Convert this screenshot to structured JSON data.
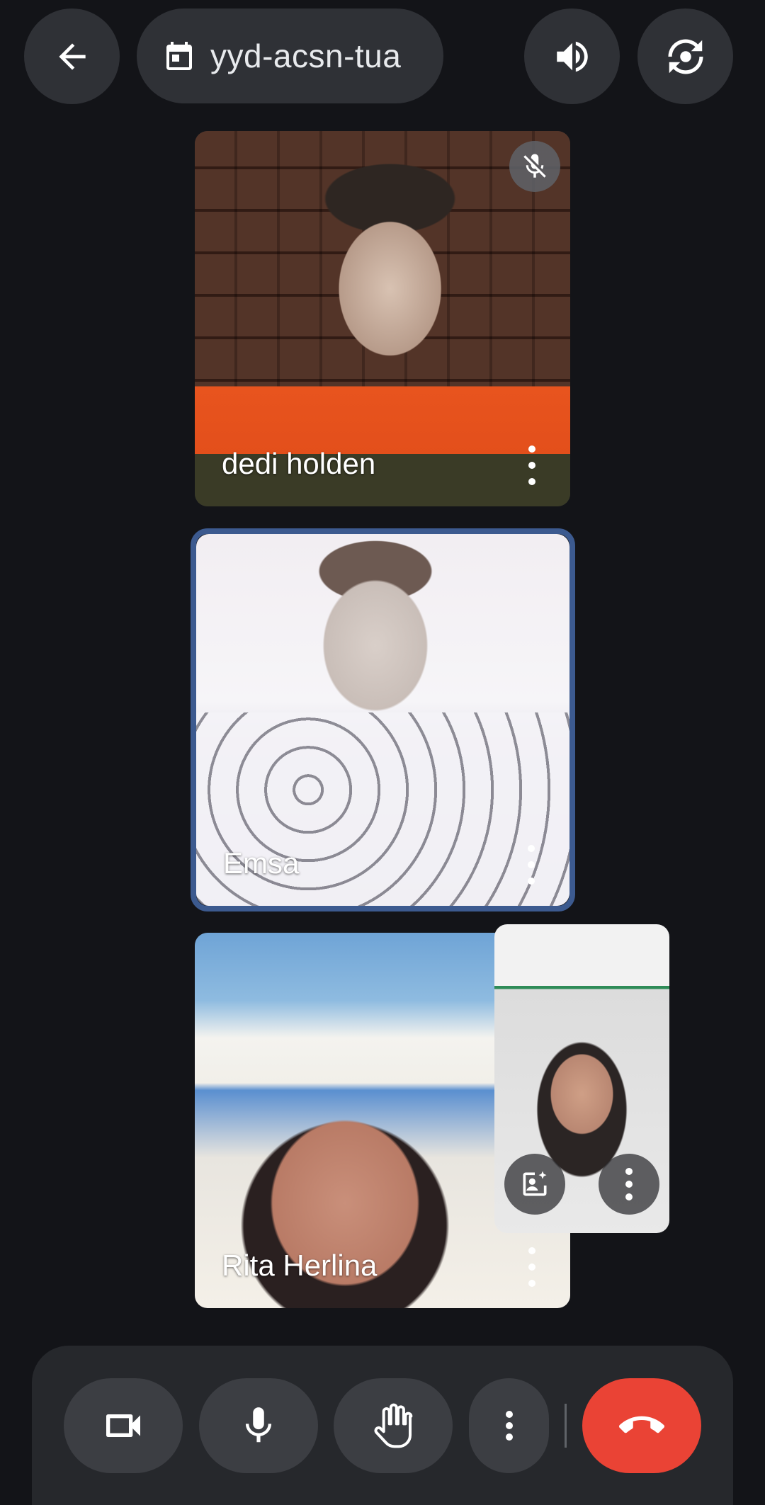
{
  "header": {
    "back_icon": "arrow-back-icon",
    "meeting_code": "yyd-acsn-tua",
    "calendar_icon": "calendar-icon",
    "speaker_icon": "volume-up-icon",
    "switch_camera_icon": "switch-camera-icon"
  },
  "participants": [
    {
      "name": "dedi holden",
      "muted": true
    },
    {
      "name": "Emsa",
      "muted": false,
      "speaking": true
    },
    {
      "name": "Rita Herlina",
      "muted": false
    }
  ],
  "self_view": {
    "effects_icon": "portrait-sparkle-icon",
    "more_icon": "more-vert-icon"
  },
  "controls": {
    "camera_icon": "videocam-icon",
    "mic_icon": "mic-icon",
    "raise_hand_icon": "hand-icon",
    "more_icon": "more-vert-icon",
    "end_call_icon": "call-end-icon",
    "end_call_color": "#ea4335"
  }
}
